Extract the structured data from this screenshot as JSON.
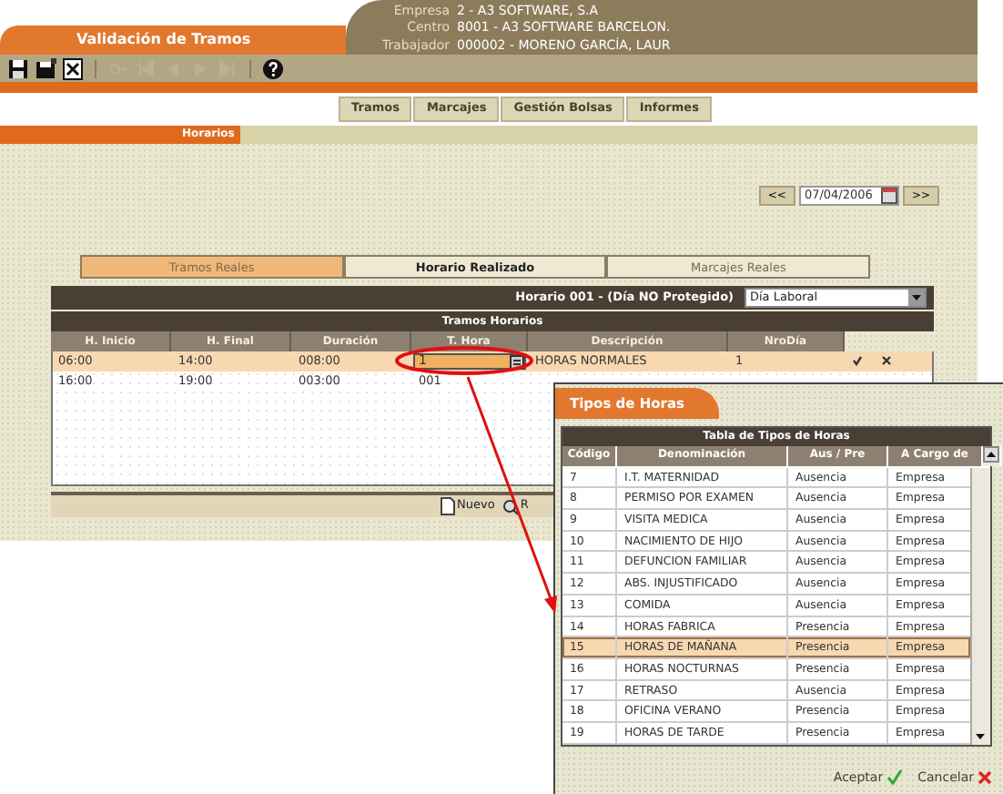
{
  "header": {
    "title": "Validación de Tramos",
    "info": [
      {
        "label": "Empresa",
        "value": "2 - A3 SOFTWARE, S.A"
      },
      {
        "label": "Centro",
        "value": "8001 - A3 SOFTWARE BARCELON."
      },
      {
        "label": "Trabajador",
        "value": "000002 - MORENO GARCÍA, LAUR"
      }
    ]
  },
  "toolbar": [
    {
      "kind": "save",
      "disabled": false
    },
    {
      "kind": "save-all",
      "disabled": false
    },
    {
      "kind": "close",
      "disabled": false
    },
    {
      "kind": "key",
      "disabled": true
    },
    {
      "kind": "first",
      "disabled": true
    },
    {
      "kind": "prev",
      "disabled": true
    },
    {
      "kind": "next",
      "disabled": true
    },
    {
      "kind": "last",
      "disabled": true
    },
    {
      "kind": "help",
      "disabled": false
    }
  ],
  "nav_tabs": [
    "Tramos",
    "Marcajes",
    "Gestión Bolsas",
    "Informes"
  ],
  "section_tab": "Horarios",
  "date_nav": {
    "prev": "<<",
    "date": "07/04/2006",
    "next": ">>"
  },
  "view_tabs": [
    {
      "label": "Tramos Reales",
      "selected": false,
      "highlighted": true
    },
    {
      "label": "Horario Realizado",
      "selected": true,
      "highlighted": false
    },
    {
      "label": "Marcajes Reales",
      "selected": false,
      "highlighted": false
    }
  ],
  "schedule": {
    "label": "Horario 001 - (Día NO Protegido)",
    "day_type": "Día Laboral"
  },
  "tramos": {
    "title": "Tramos Horarios",
    "columns": [
      "H. Inicio",
      "H. Final",
      "Duración",
      "T. Hora",
      "Descripción",
      "NroDía"
    ],
    "rows": [
      {
        "selected": true,
        "actions": true,
        "cells": [
          {
            "kind": "text",
            "text": "06:00"
          },
          {
            "kind": "text",
            "text": "14:00"
          },
          {
            "kind": "text",
            "text": "008:00"
          },
          {
            "kind": "field",
            "text": "1"
          },
          {
            "kind": "text",
            "text": "HORAS NORMALES"
          },
          {
            "kind": "text",
            "text": "1"
          }
        ]
      },
      {
        "selected": false,
        "cells": [
          {
            "kind": "text",
            "text": "16:00"
          },
          {
            "kind": "text",
            "text": "19:00"
          },
          {
            "kind": "text",
            "text": "003:00"
          },
          {
            "kind": "text",
            "text": "001"
          }
        ]
      }
    ]
  },
  "footer_buttons": [
    {
      "kind": "new",
      "label": "Nuevo"
    },
    {
      "kind": "other",
      "label": "R"
    }
  ],
  "popup": {
    "title": "Tipos de Horas",
    "table_title": "Tabla de Tipos de Horas",
    "columns": [
      "Código",
      "Denominación",
      "Aus / Pre",
      "A Cargo de"
    ],
    "rows": [
      {
        "selected": false,
        "cells": [
          "7",
          "I.T. MATERNIDAD",
          "Ausencia",
          "Empresa"
        ]
      },
      {
        "selected": false,
        "cells": [
          "8",
          "PERMISO POR EXAMEN",
          "Ausencia",
          "Empresa"
        ]
      },
      {
        "selected": false,
        "cells": [
          "9",
          "VISITA MEDICA",
          "Ausencia",
          "Empresa"
        ]
      },
      {
        "selected": false,
        "cells": [
          "10",
          "NACIMIENTO DE HIJO",
          "Ausencia",
          "Empresa"
        ]
      },
      {
        "selected": false,
        "cells": [
          "11",
          "DEFUNCION FAMILIAR",
          "Ausencia",
          "Empresa"
        ]
      },
      {
        "selected": false,
        "cells": [
          "12",
          "ABS. INJUSTIFICADO",
          "Ausencia",
          "Empresa"
        ]
      },
      {
        "selected": false,
        "cells": [
          "13",
          "COMIDA",
          "Ausencia",
          "Empresa"
        ]
      },
      {
        "selected": false,
        "cells": [
          "14",
          "HORAS FABRICA",
          "Presencia",
          "Empresa"
        ]
      },
      {
        "selected": true,
        "cells": [
          "15",
          "HORAS DE MAÑANA",
          "Presencia",
          "Empresa"
        ]
      },
      {
        "selected": false,
        "cells": [
          "16",
          "HORAS NOCTURNAS",
          "Presencia",
          "Empresa"
        ]
      },
      {
        "selected": false,
        "cells": [
          "17",
          "RETRASO",
          "Ausencia",
          "Empresa"
        ]
      },
      {
        "selected": false,
        "cells": [
          "18",
          "OFICINA VERANO",
          "Presencia",
          "Empresa"
        ]
      },
      {
        "selected": false,
        "cells": [
          "19",
          "HORAS DE TARDE",
          "Presencia",
          "Empresa"
        ]
      }
    ],
    "buttons": [
      {
        "kind": "accept",
        "label": "Aceptar"
      },
      {
        "kind": "cancel",
        "label": "Cancelar"
      }
    ]
  }
}
